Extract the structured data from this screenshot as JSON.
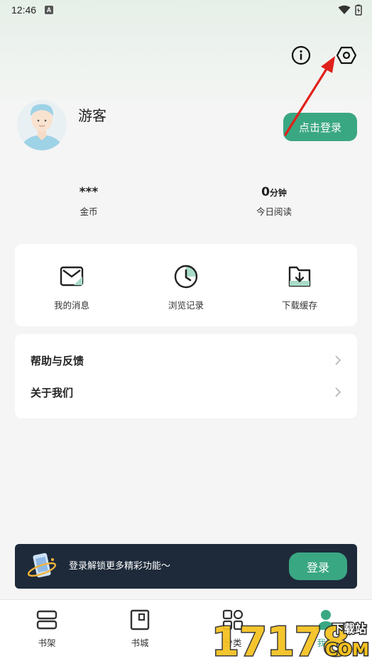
{
  "status_bar": {
    "time": "12:46",
    "notification_badge": "A"
  },
  "header": {
    "info_icon": "info-icon",
    "settings_icon": "settings-hexagon-icon"
  },
  "profile": {
    "username": "游客",
    "login_button": "点击登录"
  },
  "stats": {
    "coins": {
      "value": "***",
      "label": "金币"
    },
    "reading": {
      "value": "0",
      "unit": "分钟",
      "label": "今日阅读"
    }
  },
  "quick_actions": [
    {
      "label": "我的消息",
      "icon": "message-envelope-icon"
    },
    {
      "label": "浏览记录",
      "icon": "history-clock-icon"
    },
    {
      "label": "下载缓存",
      "icon": "download-folder-icon"
    }
  ],
  "menu": [
    {
      "label": "帮助与反馈"
    },
    {
      "label": "关于我们"
    }
  ],
  "login_banner": {
    "text": "登录解锁更多精彩功能～",
    "button": "登录"
  },
  "tabbar": [
    {
      "label": "书架",
      "icon": "bookshelf-icon",
      "active": false
    },
    {
      "label": "书城",
      "icon": "bookstore-icon",
      "active": false
    },
    {
      "label": "分类",
      "icon": "category-grid-icon",
      "active": false
    },
    {
      "label": "我的",
      "icon": "profile-icon",
      "active": true
    }
  ],
  "watermark": {
    "text": "17178",
    "suffix": "COM",
    "tag": "下载站"
  },
  "colors": {
    "accent": "#3aa783",
    "banner_bg": "#1e2a3a",
    "annotation_arrow": "#e0201a"
  }
}
